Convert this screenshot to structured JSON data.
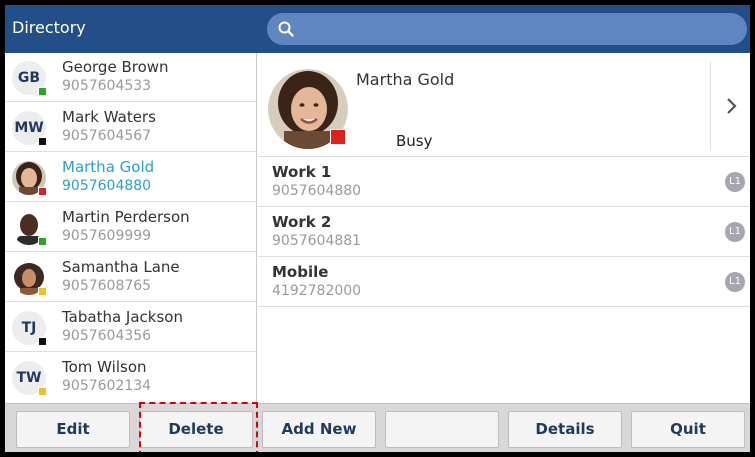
{
  "app": {
    "title": "Directory"
  },
  "search": {
    "placeholder": ""
  },
  "contacts": [
    {
      "initials": "GB",
      "name": "George Brown",
      "number": "9057604533",
      "presence_color": "#22aa22",
      "has_photo": false,
      "selected": false
    },
    {
      "initials": "MW",
      "name": "Mark Waters",
      "number": "9057604567",
      "presence_color": "#111111",
      "has_photo": false,
      "selected": false
    },
    {
      "initials": "",
      "name": "Martha Gold",
      "number": "9057604880",
      "presence_color": "#e02020",
      "has_photo": true,
      "selected": true
    },
    {
      "initials": "",
      "name": "Martin Perderson",
      "number": "9057609999",
      "presence_color": "#22aa22",
      "has_photo": true,
      "selected": false
    },
    {
      "initials": "",
      "name": "Samantha Lane",
      "number": "9057608765",
      "presence_color": "#f0c020",
      "has_photo": true,
      "selected": false
    },
    {
      "initials": "TJ",
      "name": "Tabatha Jackson",
      "number": "9057604356",
      "presence_color": "#111111",
      "has_photo": false,
      "selected": false
    },
    {
      "initials": "TW",
      "name": "Tom Wilson",
      "number": "9057602134",
      "presence_color": "#f0c020",
      "has_photo": false,
      "selected": false
    }
  ],
  "detail": {
    "name": "Martha Gold",
    "status": "Busy",
    "status_color": "#e02020",
    "numbers": [
      {
        "label": "Work 1",
        "value": "9057604880",
        "line": "L1"
      },
      {
        "label": "Work 2",
        "value": "9057604881",
        "line": "L1"
      },
      {
        "label": "Mobile",
        "value": "4192782000",
        "line": "L1"
      }
    ]
  },
  "softkeys": {
    "edit": "Edit",
    "delete": "Delete",
    "add_new": "Add New",
    "blank": "",
    "details": "Details",
    "quit": "Quit"
  },
  "icons": {
    "search": "search-icon",
    "next": "chevron-right-icon"
  },
  "colors": {
    "header": "#234f88",
    "selected_text": "#2a9fd6",
    "highlight": "#e00000"
  }
}
